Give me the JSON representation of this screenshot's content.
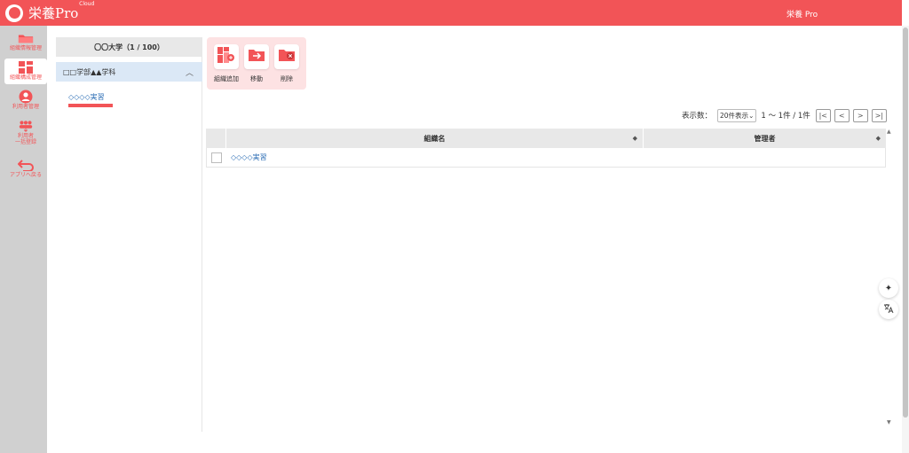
{
  "header": {
    "logo_text": "栄養Pro",
    "logo_sup": "Cloud",
    "user_name": "栄養 Pro"
  },
  "sidebar": {
    "items": [
      {
        "label": "組織情報管理",
        "icon": "folder-icon"
      },
      {
        "label": "組織構成管理",
        "icon": "org-structure-icon"
      },
      {
        "label": "利用者管理",
        "icon": "user-icon"
      },
      {
        "label": "利用者\n一括登録",
        "icon": "users-bulk-icon"
      },
      {
        "label": "アプリへ戻る",
        "icon": "return-icon"
      }
    ]
  },
  "tree": {
    "root": "〇〇大学（1 / 100）",
    "sub": "□□学部▲▲学科",
    "leaf": "◇◇◇◇実習"
  },
  "actions": [
    {
      "label": "組織追加",
      "icon": "add-org-icon"
    },
    {
      "label": "移動",
      "icon": "move-icon"
    },
    {
      "label": "削除",
      "icon": "delete-icon"
    }
  ],
  "pager": {
    "label": "表示数：",
    "per_page": "20件表示",
    "count": "1 〜 1件 / 1件",
    "first": "|<",
    "prev": "<",
    "next": ">",
    "last": ">|"
  },
  "table": {
    "headers": {
      "name": "組織名",
      "admin": "管理者"
    },
    "rows": [
      {
        "name": "◇◇◇◇実習",
        "admin": ""
      }
    ]
  },
  "colors": {
    "accent": "#f25457",
    "link": "#2c6eb5",
    "panel": "#fde2e3"
  }
}
